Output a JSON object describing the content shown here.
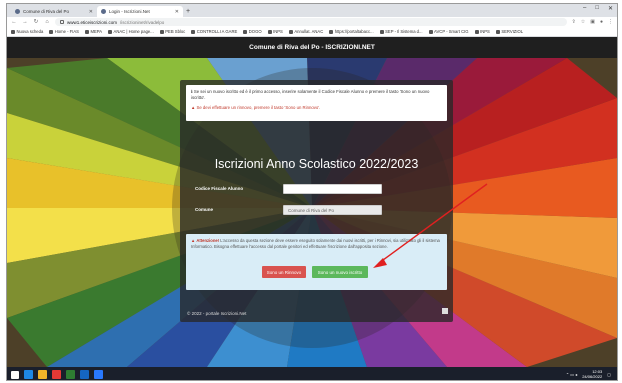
{
  "browser": {
    "tabs": [
      {
        "label": "Comune di Riva del Po",
        "active": false
      },
      {
        "label": "Login - Iscrizioni.Net",
        "active": true
      }
    ],
    "new_tab": "+",
    "window_controls": [
      "–",
      "□",
      "✕"
    ],
    "url_host": "www1.eticeiscrizioni.com",
    "url_path": "/iscrizioninet/rivadelpo",
    "bookmarks": [
      "Nuova scheda",
      "Home - FIAS",
      "MEPA",
      "ANAC | Home page...",
      "PEB Sbloc",
      "CONTROLLI A GARE",
      "DOGO",
      "INPS",
      "Annullat. ANAC",
      "https://portaltabacc...",
      "SEP - Il Sistema d...",
      "AVCP - Smart CIG",
      "INPS",
      "SERVIZIOL"
    ]
  },
  "site": {
    "header_title": "Comune di Riva del Po - ISCRIZIONI.NET",
    "alert_top": {
      "info": "Se sei un nuovo iscritto ed è il primo accesso, inserire solamente il Codice Fiscale Alunno e premere il tasto 'Sono un nuovo iscritto'.",
      "warning": "Se devi effettuare un rinnovo, premere il tasto 'Sono un Rinnovo'."
    },
    "page_title": "Iscrizioni Anno Scolastico 2022/2023",
    "form": {
      "codice_label": "Codice Fiscale Alunno",
      "codice_value": "",
      "comune_label": "Comune",
      "comune_value": "Comune di Riva del Po"
    },
    "alert_bottom": {
      "title": "Attenzione!",
      "text": "L'accesso da questa sezione deve essere eseguito solamente dai nuovi iscritti, per i Rinnovi, sia utilizzato gli il sistema Informatico. Bisogna effettuare l'accesso dal portale genitori ed effettuare l'iscrizione dall'apposita sezione."
    },
    "buttons": {
      "rinnovo": "Sono un Rinnovo",
      "nuovo": "Sono un nuovo iscritto"
    },
    "footer": "© 2022 - portale Iscrizioni.Net"
  },
  "taskbar": {
    "time": "12:03",
    "date": "24/06/2022"
  },
  "colors": {
    "header_bg": "#1f1f1f",
    "panel_bg": "rgba(40,40,40,0.78)",
    "rinnovo_btn": "#d9534f",
    "nuovo_btn": "#5cb85c",
    "annotation_arrow": "#e02020"
  }
}
